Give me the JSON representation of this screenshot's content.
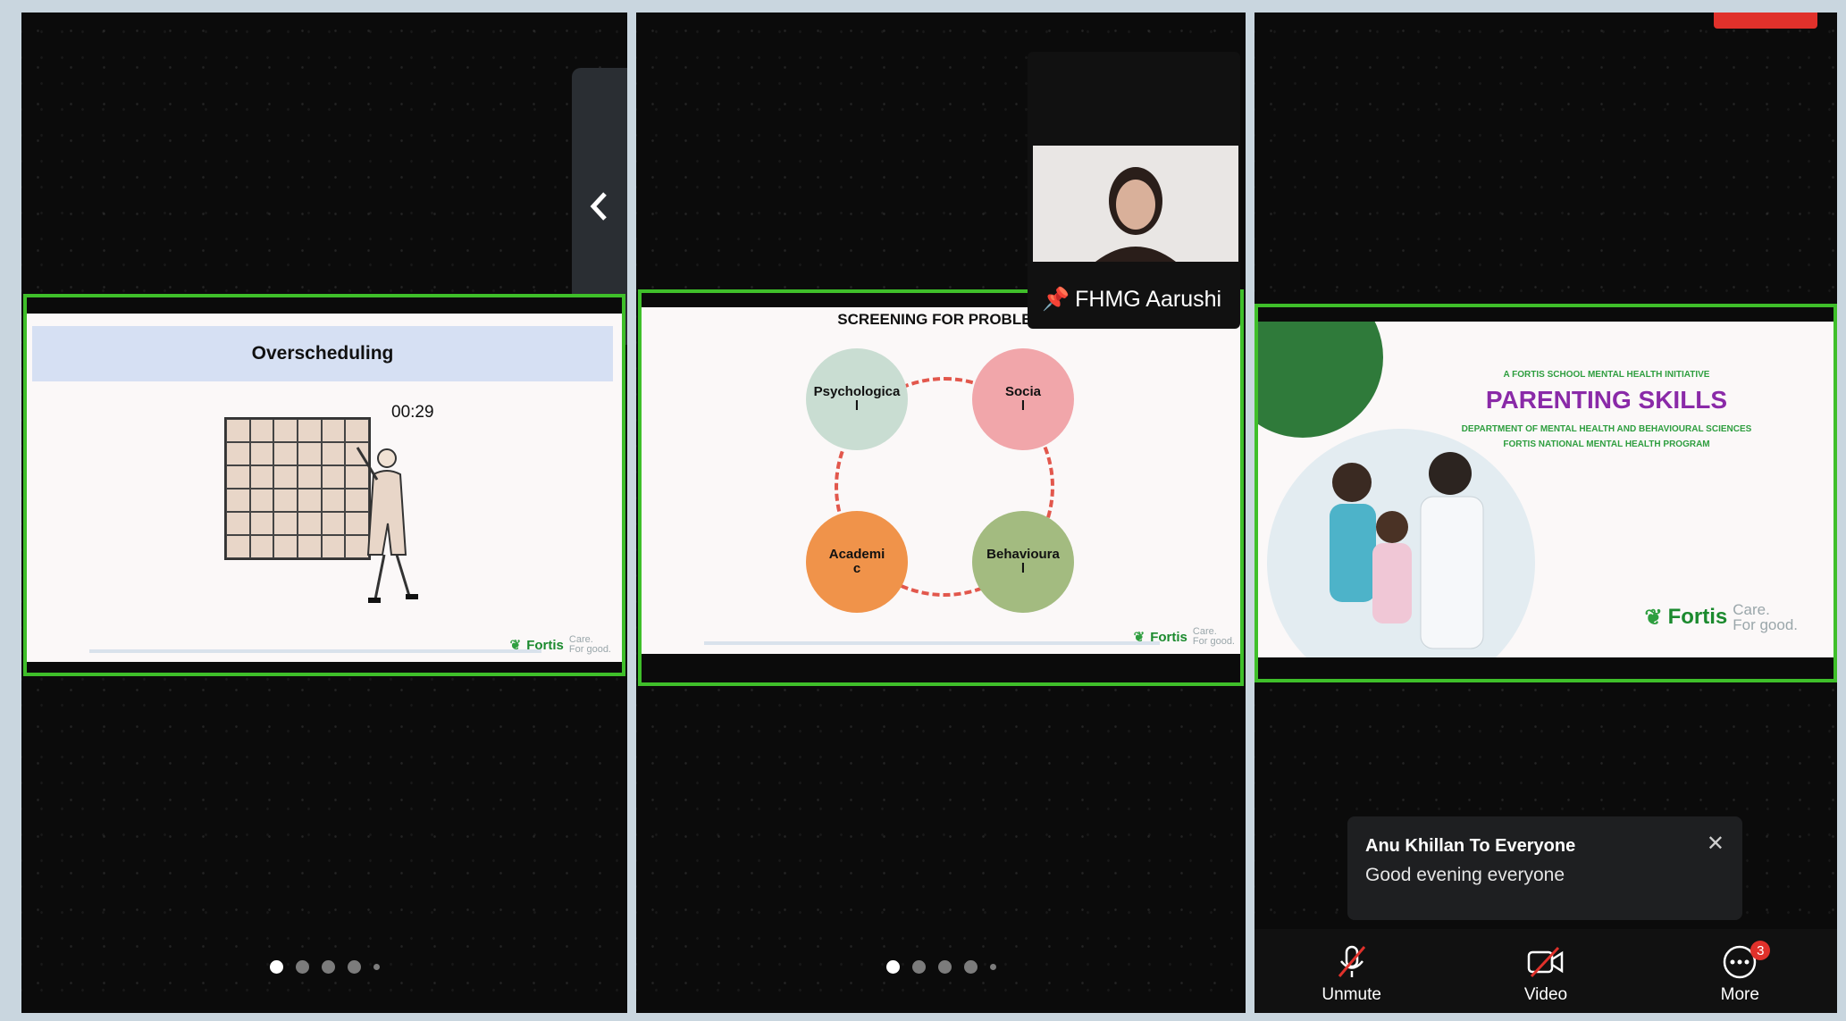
{
  "panels": {
    "left": {
      "slide_title": "Overscheduling",
      "timer": "00:29",
      "footer_brand": "Fortis",
      "footer_tagline_1": "Care.",
      "footer_tagline_2": "For good.",
      "page_dots": 5,
      "active_dot": 0
    },
    "middle": {
      "slide_title": "SCREENING FOR PROBLEM",
      "circles": [
        {
          "label_1": "Psychologica",
          "label_2": "l",
          "color": "#c9ddd2"
        },
        {
          "label_1": "Socia",
          "label_2": "l",
          "color": "#f1a6aa"
        },
        {
          "label_1": "Academi",
          "label_2": "c",
          "color": "#f0934a"
        },
        {
          "label_1": "Behavioura",
          "label_2": "l",
          "color": "#a3bb80"
        }
      ],
      "footer_brand": "Fortis",
      "footer_tagline_1": "Care.",
      "footer_tagline_2": "For good.",
      "presenter_name": "FHMG Aarushi",
      "page_dots": 5,
      "active_dot": 0
    },
    "right": {
      "initiative": "A FORTIS SCHOOL MENTAL HEALTH INITIATIVE",
      "title": "PARENTING SKILLS",
      "subtitle_1": "DEPARTMENT OF MENTAL HEALTH AND BEHAVIOURAL SCIENCES",
      "subtitle_2": "FORTIS NATIONAL MENTAL HEALTH PROGRAM",
      "footer_brand": "Fortis",
      "footer_tagline_1": "Care.",
      "footer_tagline_2": "For good."
    }
  },
  "chat_toast": {
    "sender": "Anu Khillan To Everyone",
    "message": "Good evening  everyone"
  },
  "controls": {
    "unmute_label": "Unmute",
    "video_label": "Video",
    "more_label": "More",
    "more_badge": "3"
  },
  "colors": {
    "active_speaker_border": "#3fbf2a",
    "brand_green": "#1b8a2e",
    "title_purple": "#8a2aa8",
    "badge_red": "#e0312b"
  }
}
